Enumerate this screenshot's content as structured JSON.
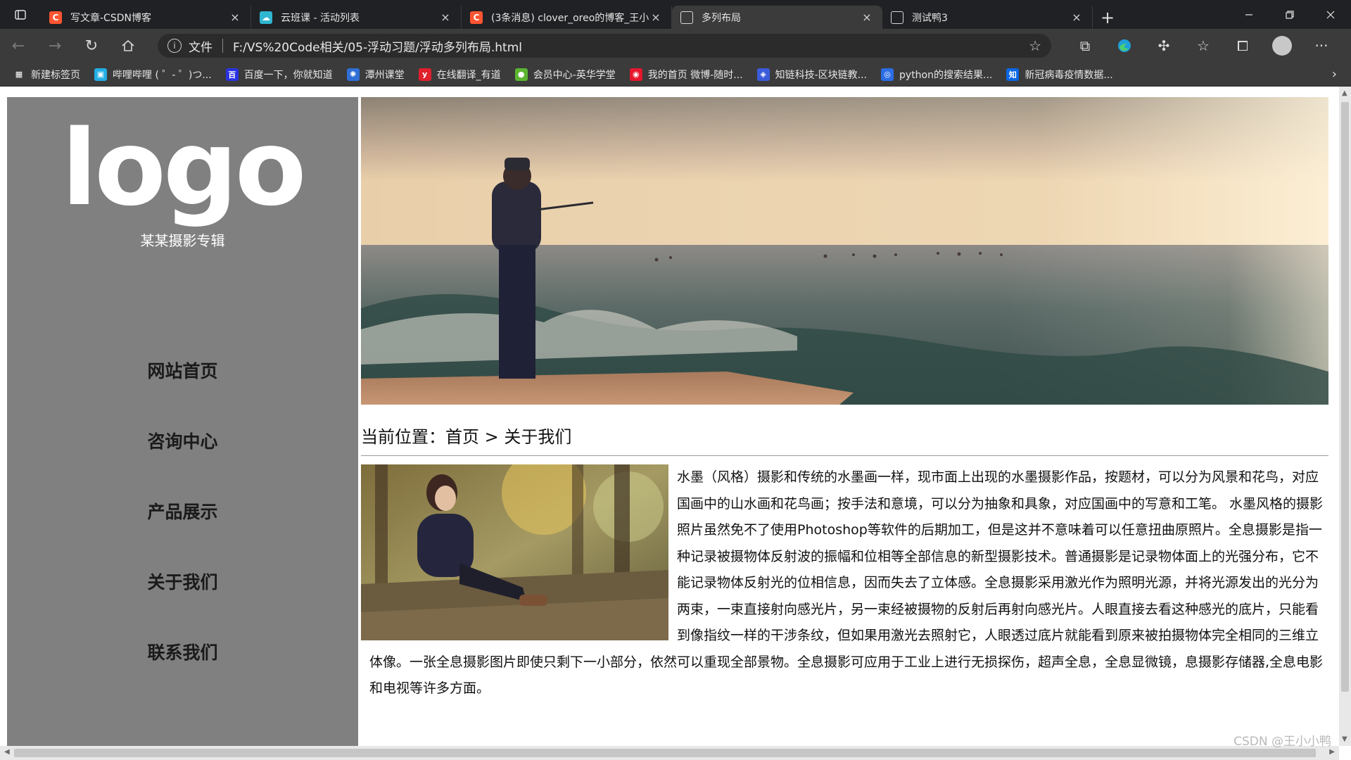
{
  "browser": {
    "tabs": [
      {
        "title": "写文章-CSDN博客",
        "favicon": "csdn-icon",
        "favicon_glyph": "C",
        "favicon_color": "#fc5531",
        "active": false
      },
      {
        "title": "云班课 - 活动列表",
        "favicon": "cloud-class-icon",
        "favicon_glyph": "☁",
        "favicon_color": "#2fb6d0",
        "active": false
      },
      {
        "title": "(3条消息) clover_oreo的博客_王小",
        "favicon": "csdn-icon",
        "favicon_glyph": "C",
        "favicon_color": "#fc5531",
        "active": false
      },
      {
        "title": "多列布局",
        "favicon": "page-icon",
        "favicon_glyph": "▯",
        "favicon_color": "#3b3b3b",
        "active": true
      },
      {
        "title": "测试鸭3",
        "favicon": "page-icon",
        "favicon_glyph": "▯",
        "favicon_color": "#202124",
        "active": false
      }
    ],
    "new_tab_glyph": "+",
    "address": {
      "scheme_label": "文件",
      "url": "F:/VS%20Code相关/05-浮动习题/浮动多列布局.html"
    },
    "bookmarks": [
      {
        "label": "新建标签页",
        "icon": "new-tab-icon",
        "glyph": "▦",
        "color": "#3b3b3b"
      },
      {
        "label": "哔哩哔哩 ( ゜- ゜)つ...",
        "icon": "bilibili-icon",
        "glyph": "▣",
        "color": "#23ade5"
      },
      {
        "label": "百度一下，你就知道",
        "icon": "baidu-icon",
        "glyph": "百",
        "color": "#2932e1"
      },
      {
        "label": "潭州课堂",
        "icon": "tanzhou-icon",
        "glyph": "✺",
        "color": "#2f6fd6"
      },
      {
        "label": "在线翻译_有道",
        "icon": "youdao-icon",
        "glyph": "y",
        "color": "#e0202b"
      },
      {
        "label": "会员中心-英华学堂",
        "icon": "yinghua-icon",
        "glyph": "●",
        "color": "#5cb531"
      },
      {
        "label": "我的首页 微博-随时...",
        "icon": "weibo-icon",
        "glyph": "◉",
        "color": "#e6162d"
      },
      {
        "label": "知链科技-区块链教...",
        "icon": "zhilian-icon",
        "glyph": "◈",
        "color": "#3b5bdb"
      },
      {
        "label": "python的搜索结果...",
        "icon": "search-engine-icon",
        "glyph": "◎",
        "color": "#2b6de5"
      },
      {
        "label": "新冠病毒疫情数据...",
        "icon": "zhihu-icon",
        "glyph": "知",
        "color": "#0a66e4"
      }
    ]
  },
  "page": {
    "sidebar": {
      "logo": "logo",
      "subtitle": "某某摄影专辑",
      "nav": [
        "网站首页",
        "咨询中心",
        "产品展示",
        "关于我们",
        "联系我们"
      ]
    },
    "breadcrumb": "当前位置：首页 > 关于我们",
    "article": "水墨（风格）摄影和传统的水墨画一样，现市面上出现的水墨摄影作品，按题材，可以分为风景和花鸟，对应国画中的山水画和花鸟画；按手法和意境，可以分为抽象和具象，对应国画中的写意和工笔。 水墨风格的摄影照片虽然免不了使用Photoshop等软件的后期加工，但是这并不意味着可以任意扭曲原照片。全息摄影是指一种记录被摄物体反射波的振幅和位相等全部信息的新型摄影技术。普通摄影是记录物体面上的光强分布，它不能记录物体反射光的位相信息，因而失去了立体感。全息摄影采用激光作为照明光源，并将光源发出的光分为两束，一束直接射向感光片，另一束经被摄物的反射后再射向感光片。人眼直接去看这种感光的底片，只能看到像指纹一样的干涉条纹，但如果用激光去照射它，人眼透过底片就能看到原来被拍摄物体完全相同的三维立体像。一张全息摄影图片即使只剩下一小部分，依然可以重现全部景物。全息摄影可应用于工业上进行无损探伤，超声全息，全息显微镜，息摄影存储器,全息电影和电视等许多方面。"
  },
  "watermark": "CSDN @王小小鸭"
}
